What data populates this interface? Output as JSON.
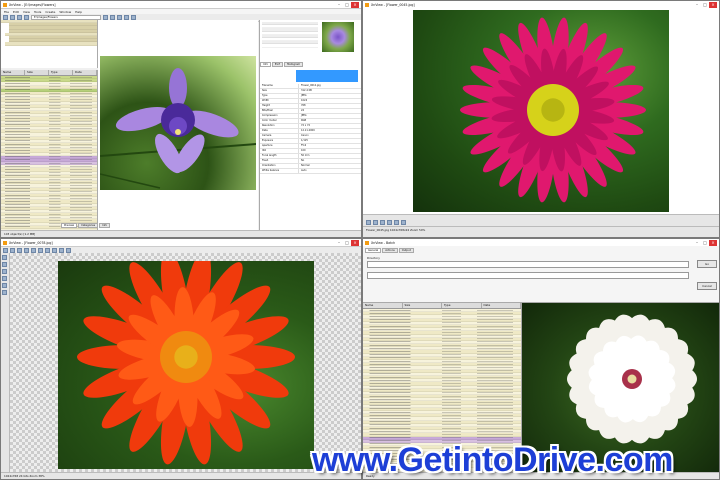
{
  "top_left": {
    "title": "XnView - [E:\\Images\\Flowers]",
    "menu": [
      "File",
      "Edit",
      "View",
      "Tools",
      "Create",
      "Window",
      "Help"
    ],
    "path": "E:\\Images\\Flowers",
    "columns": [
      "Name",
      "Size",
      "Type",
      "Date"
    ],
    "tabs": [
      "Info",
      "Exif",
      "Histogram"
    ],
    "bottom_tabs": [
      "Preview",
      "Categories",
      "Info"
    ],
    "status": "103 object(s) [1.2 MB]",
    "props": [
      [
        "Filename",
        "Flower_0012.jpg"
      ],
      [
        "Size",
        "312.4 KB"
      ],
      [
        "Type",
        "JPEG"
      ],
      [
        "Width",
        "1024"
      ],
      [
        "Height",
        "768"
      ],
      [
        "Bits/Pixel",
        "24"
      ],
      [
        "Compression",
        "JPEG"
      ],
      [
        "Color model",
        "RGB"
      ],
      [
        "Resolution",
        "72 x 72"
      ],
      [
        "Date",
        "12.11.2009"
      ],
      [
        "Camera",
        "Canon"
      ],
      [
        "Exposure",
        "1/125"
      ],
      [
        "Aperture",
        "F5.6"
      ],
      [
        "ISO",
        "100"
      ],
      [
        "Focal length",
        "50 mm"
      ],
      [
        "Flash",
        "No"
      ],
      [
        "Orientation",
        "Normal"
      ],
      [
        "White balance",
        "Auto"
      ]
    ]
  },
  "top_right": {
    "title": "XnView - [Flower_0045.jpg]",
    "status": "Flower_0045.jpg  1024x768x24  Zoom 50%"
  },
  "bottom_left": {
    "title": "XnView - [Flower_0078.jpg]",
    "status": "1024x768 24 bits  Zoom 38%"
  },
  "bottom_right": {
    "title": "XnView - Batch",
    "tabs": [
      "General",
      "Actions",
      "Output"
    ],
    "field_label": "Directory",
    "ok_label": "Go",
    "cancel_label": "Cancel",
    "status": "Ready"
  },
  "watermark": "www.GetintoDrive.com",
  "colors": {
    "window_bg": "#f0f0f0",
    "selection": "#3399ff",
    "watermark": "#1d3fd6"
  }
}
